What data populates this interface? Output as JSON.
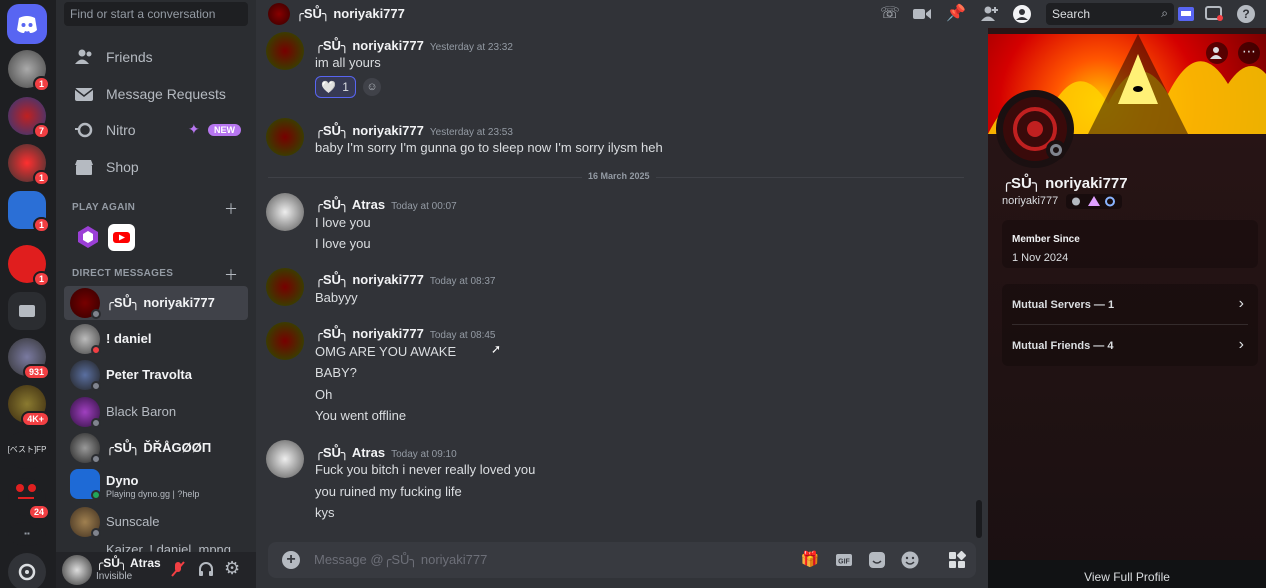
{
  "colors": {
    "accent": "#5865f2",
    "badge": "#f23f43",
    "online": "#23a55a",
    "offline": "#80848e",
    "dnd": "#f23f43"
  },
  "servers": [
    {
      "icon": "discord-logo-icon",
      "badge": ""
    },
    {
      "badge": "1"
    },
    {
      "badge": "7"
    },
    {
      "badge": "1"
    },
    {
      "badge": "1"
    },
    {
      "badge": "1"
    },
    {
      "badge": ""
    },
    {
      "badge": "931"
    },
    {
      "badge": "4K+"
    },
    {
      "label": "[ベスト]FP",
      "badge": ""
    },
    {
      "badge": "24"
    },
    {
      "badge": ""
    },
    {
      "icon": "discover-icon",
      "badge": ""
    }
  ],
  "dm_search_placeholder": "Find or start a conversation",
  "nav": {
    "friends": "Friends",
    "requests": "Message Requests",
    "nitro": "Nitro",
    "nitro_badge": "NEW",
    "shop": "Shop"
  },
  "play_again": "PLAY AGAIN",
  "direct_messages": "DIRECT MESSAGES",
  "dms": [
    {
      "name": "╭ЅŮ╮ noriyaki777",
      "status": "offline",
      "sub": ""
    },
    {
      "name": "! daniel",
      "status": "dnd",
      "sub": ""
    },
    {
      "name": "Peter Travolta",
      "status": "offline",
      "sub": ""
    },
    {
      "name": "Black Baron",
      "status": "offline",
      "sub": ""
    },
    {
      "name": "╭ЅŮ╮ ĎŘÅGØØП",
      "status": "offline",
      "sub": ""
    },
    {
      "name": "Dyno",
      "status": "online",
      "sub": "Playing dyno.gg | ?help"
    },
    {
      "name": "Sunscale",
      "status": "offline",
      "sub": ""
    },
    {
      "name": "Kaizer, ! daniel, mpng",
      "status": "",
      "sub": ""
    }
  ],
  "user": {
    "name": "╭ЅŮ╮ Atras",
    "status": "Invisible"
  },
  "topbar": {
    "title": "╭ЅŮ╮ noriyaki777",
    "search": "Search"
  },
  "messages": [
    {
      "author": "╭ЅŮ╮ noriyaki777",
      "time": "Yesterday at 23:32",
      "lines": [
        "im all yours"
      ]
    },
    {
      "author": "╭ЅŮ╮ noriyaki777",
      "time": "Yesterday at 23:53",
      "lines": [
        "baby I'm sorry I'm gunna go to sleep now I'm sorry ilysm heh"
      ]
    },
    {
      "author": "╭ЅŮ╮ Atras",
      "time": "Today at 00:07",
      "lines": [
        "I love you",
        "I love you"
      ]
    },
    {
      "author": "╭ЅŮ╮ noriyaki777",
      "time": "Today at 08:37",
      "lines": [
        "Babyyy"
      ]
    },
    {
      "author": "╭ЅŮ╮ noriyaki777",
      "time": "Today at 08:45",
      "lines": [
        "OMG ARE YOU AWAKE",
        "BABY?",
        "Oh",
        "You went offline"
      ]
    },
    {
      "author": "╭ЅŮ╮ Atras",
      "time": "Today at 09:10",
      "lines": [
        "Fuck you bitch i never really loved you",
        "you ruined my fucking life",
        "kys"
      ]
    }
  ],
  "reaction": {
    "emoji": "🤍",
    "count": "1"
  },
  "date_divider": "16 March 2025",
  "composer_placeholder": "Message @╭ЅŮ╮ noriyaki777",
  "profile": {
    "display_name": "╭ЅŮ╮ noriyaki777",
    "username": "noriyaki777",
    "member_since_label": "Member Since",
    "member_since": "1 Nov 2024",
    "mutual_servers": "Mutual Servers — 1",
    "mutual_friends": "Mutual Friends — 4",
    "view_full": "View Full Profile"
  }
}
